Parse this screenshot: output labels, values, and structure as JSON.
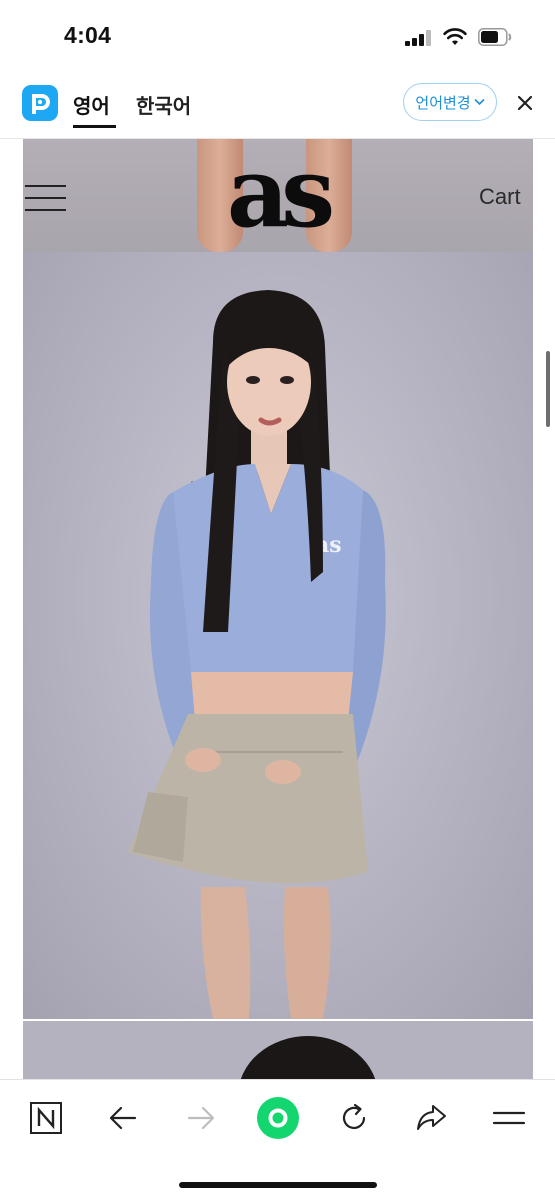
{
  "status_bar": {
    "time": "4:04"
  },
  "translate_bar": {
    "tab_english": "영어",
    "tab_korean": "한국어",
    "change_language": "언어변경"
  },
  "site_header": {
    "brand": "as",
    "cart": "Cart"
  },
  "colors": {
    "papago_blue": "#1ea7f2",
    "accent_green": "#13d66e",
    "sweater_blue": "#93a6d4",
    "skirt_beige": "#bdb4a8"
  },
  "icons": {
    "toolbar": [
      "naver-n-icon",
      "back-arrow-icon",
      "forward-arrow-icon",
      "green-home-icon",
      "refresh-icon",
      "share-icon",
      "menu-icon"
    ]
  }
}
